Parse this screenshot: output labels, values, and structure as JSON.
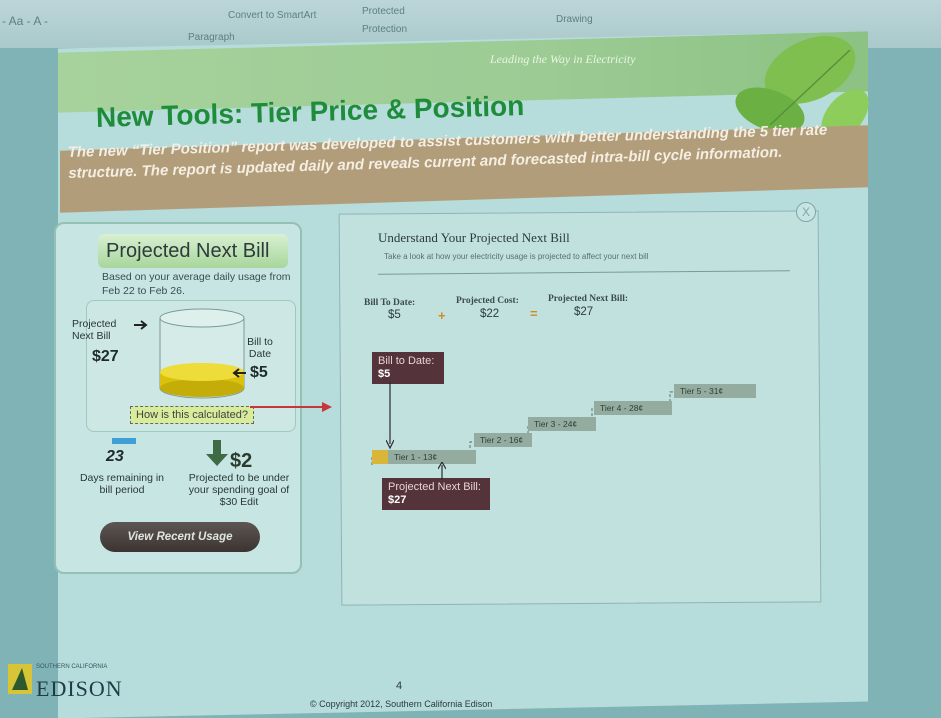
{
  "ribbon": {
    "left_text": "- Aa - A -",
    "smartart": "Convert to SmartArt",
    "protected": "Protected",
    "protection": "Protection",
    "paragraph": "Paragraph",
    "drawing": "Drawing"
  },
  "slide": {
    "tagline": "Leading the Way in Electricity",
    "title": "New Tools: Tier Price & Position",
    "subtitle": "The new “Tier Position” report was developed to assist customers with better understanding the 5 tier rate structure. The report is updated daily and reveals current and forecasted intra-bill cycle information.",
    "page_number": "4",
    "copyright": "© Copyright 2012, Southern California Edison"
  },
  "card": {
    "title": "Projected Next Bill",
    "based_on": "Based on your average daily usage from Feb 22 to Feb 26.",
    "projected_label": "Projected Next Bill",
    "projected_value": "$27",
    "bill_to_date_label": "Bill to Date",
    "bill_to_date_value": "$5",
    "how_calculated": "How is this calculated?",
    "days_value": "23",
    "days_label": "Days remaining in bill period",
    "under_value": "$2",
    "under_label": "Projected to be under your spending goal of $30 Edit",
    "view_button": "View Recent Usage"
  },
  "panel": {
    "title": "Understand Your Projected Next Bill",
    "subtitle": "Take a look at how your electricity usage is projected to affect your next bill",
    "bill_to_date_hd": "Bill To Date:",
    "bill_to_date_val": "$5",
    "plus": "+",
    "projected_cost_hd": "Projected Cost:",
    "projected_cost_val": "$22",
    "equals": "=",
    "projected_next_hd": "Projected Next Bill:",
    "projected_next_val": "$27",
    "callout_top_label": "Bill to Date:",
    "callout_top_value": "$5",
    "callout_bottom_label": "Projected Next Bill:",
    "callout_bottom_value": "$27",
    "tiers": [
      "Tier 1 - 13¢",
      "Tier 2 - 16¢",
      "Tier 3 - 24¢",
      "Tier 4 - 28¢",
      "Tier 5 - 31¢"
    ],
    "close": "X"
  },
  "footer": {
    "brand_small": "SOUTHERN CALIFORNIA",
    "brand": "EDISON"
  },
  "colors": {
    "title_green": "#1f8c3a",
    "subbar_tan": "#b29d7a",
    "callout": "#54343a",
    "accent_orange": "#d28b22"
  }
}
